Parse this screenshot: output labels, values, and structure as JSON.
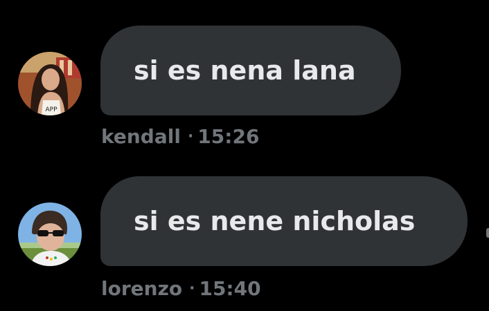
{
  "messages": [
    {
      "text": "si es nena lana",
      "sender": "kendall",
      "separator": "·",
      "time": "15:26",
      "avatar_icon": "kendall-avatar"
    },
    {
      "text": "si es nene nicholas",
      "sender": "lorenzo",
      "separator": "·",
      "time": "15:40",
      "avatar_icon": "lorenzo-avatar"
    }
  ],
  "colors": {
    "background": "#000000",
    "bubble": "#2f3336",
    "bubble_text": "#e7e9ea",
    "meta_text": "#71767b"
  }
}
